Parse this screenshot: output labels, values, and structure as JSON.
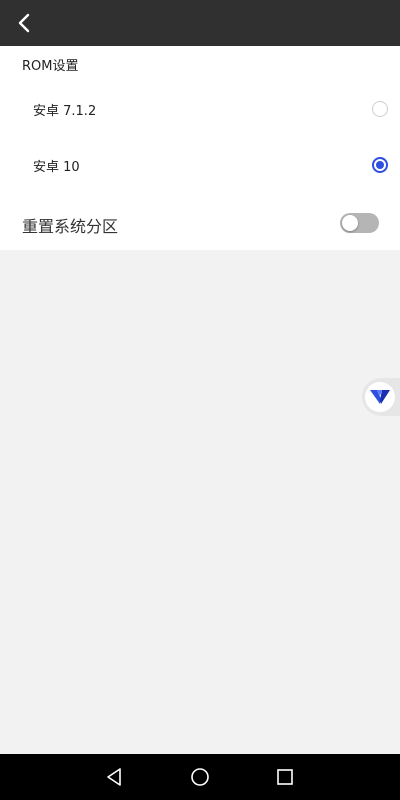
{
  "header": {
    "back_icon": "chevron-left-icon"
  },
  "rom_settings": {
    "section_title": "ROM设置",
    "options": [
      {
        "label": "安卓 7.1.2",
        "selected": false
      },
      {
        "label": "安卓 10",
        "selected": true
      }
    ],
    "reset_label": "重置系统分区",
    "reset_enabled": false
  },
  "floating_button": {
    "icon": "v-logo-icon"
  },
  "nav_bar": {
    "back_icon": "triangle-back-icon",
    "home_icon": "circle-home-icon",
    "recent_icon": "square-recent-icon"
  },
  "colors": {
    "accent": "#2f4fe0",
    "app_bar": "#303030",
    "toggle_off": "#b5b5b5"
  }
}
